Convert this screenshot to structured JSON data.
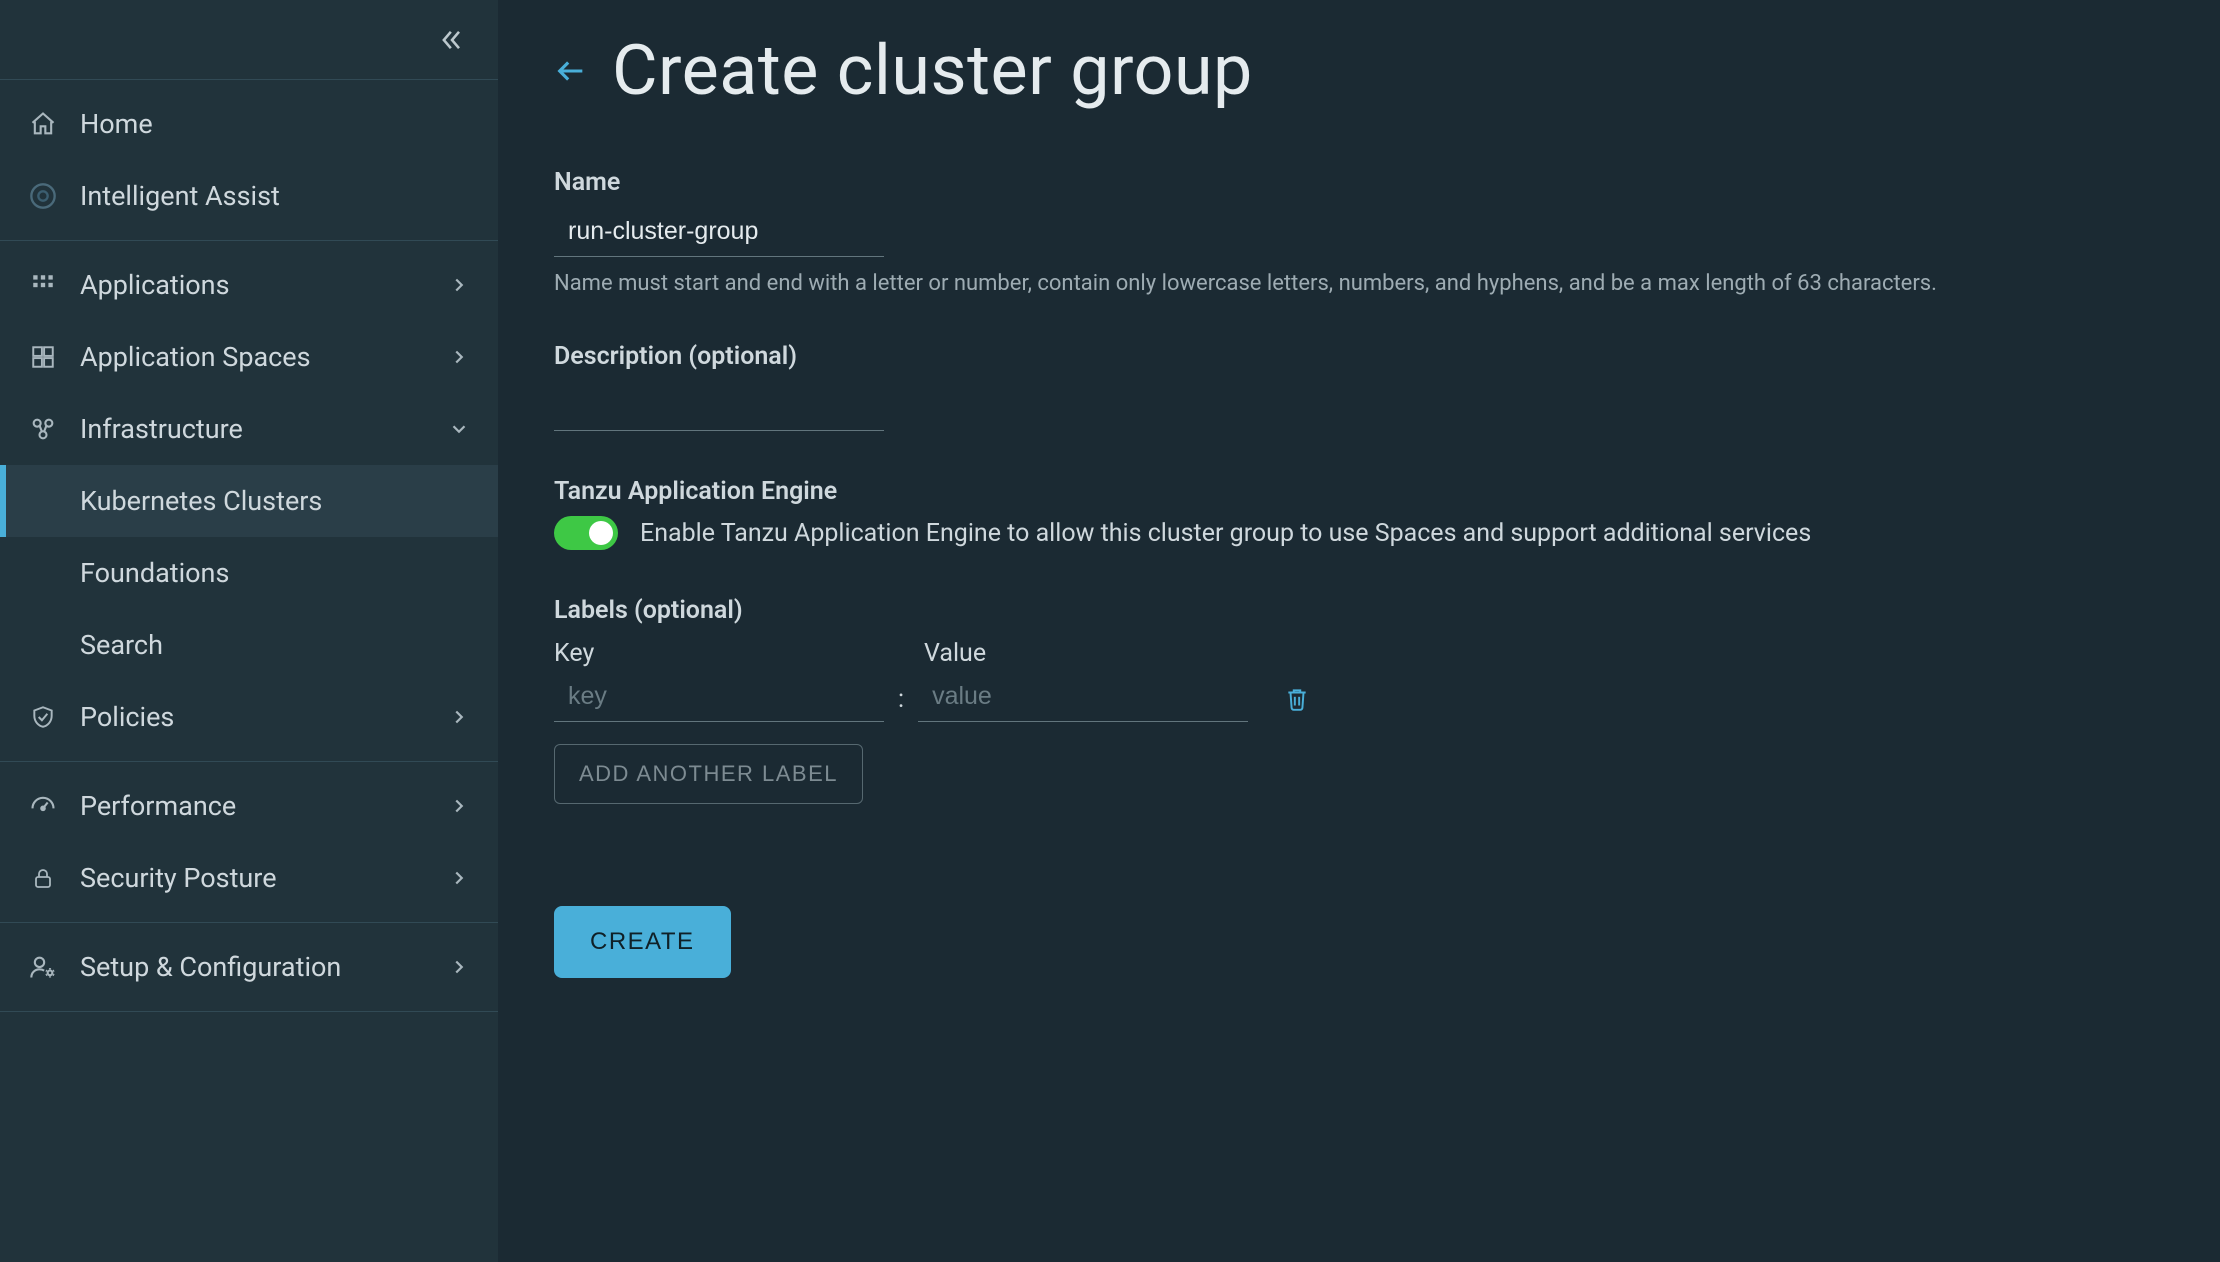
{
  "sidebar": {
    "groups": [
      {
        "items": [
          {
            "id": "home",
            "icon": "home",
            "label": "Home",
            "expandable": false
          },
          {
            "id": "assist",
            "icon": "assist",
            "label": "Intelligent Assist",
            "expandable": false
          }
        ]
      },
      {
        "items": [
          {
            "id": "apps",
            "icon": "grid",
            "label": "Applications",
            "expandable": true,
            "expanded": false
          },
          {
            "id": "appspaces",
            "icon": "grid2",
            "label": "Application Spaces",
            "expandable": true,
            "expanded": false
          },
          {
            "id": "infra",
            "icon": "nodes",
            "label": "Infrastructure",
            "expandable": true,
            "expanded": true,
            "children": [
              {
                "id": "k8s",
                "label": "Kubernetes Clusters",
                "active": true
              },
              {
                "id": "foundations",
                "label": "Foundations",
                "active": false
              },
              {
                "id": "search",
                "label": "Search",
                "active": false
              }
            ]
          },
          {
            "id": "policies",
            "icon": "shield",
            "label": "Policies",
            "expandable": true,
            "expanded": false
          }
        ]
      },
      {
        "items": [
          {
            "id": "perf",
            "icon": "gauge",
            "label": "Performance",
            "expandable": true,
            "expanded": false
          },
          {
            "id": "sec",
            "icon": "lock",
            "label": "Security Posture",
            "expandable": true,
            "expanded": false
          }
        ]
      },
      {
        "items": [
          {
            "id": "setup",
            "icon": "usercog",
            "label": "Setup & Configuration",
            "expandable": true,
            "expanded": false
          }
        ]
      }
    ]
  },
  "page": {
    "title": "Create cluster group",
    "name_label": "Name",
    "name_value": "run-cluster-group",
    "name_helper": "Name must start and end with a letter or number, contain only lowercase letters, numbers, and hyphens, and be a max length of 63 characters.",
    "description_label": "Description (optional)",
    "description_value": "",
    "tae_heading": "Tanzu Application Engine",
    "tae_enabled": true,
    "tae_text": "Enable Tanzu Application Engine to allow this cluster group to use Spaces and support additional services",
    "labels_heading": "Labels (optional)",
    "key_col": "Key",
    "value_col": "Value",
    "key_placeholder": "key",
    "value_placeholder": "value",
    "key_value": "",
    "value_value": "",
    "add_label_btn": "ADD ANOTHER LABEL",
    "create_btn": "CREATE"
  },
  "colors": {
    "accent": "#49afd9",
    "toggle_on": "#3ec845",
    "bg_main": "#1b2a33",
    "bg_sidebar": "#21333b"
  }
}
